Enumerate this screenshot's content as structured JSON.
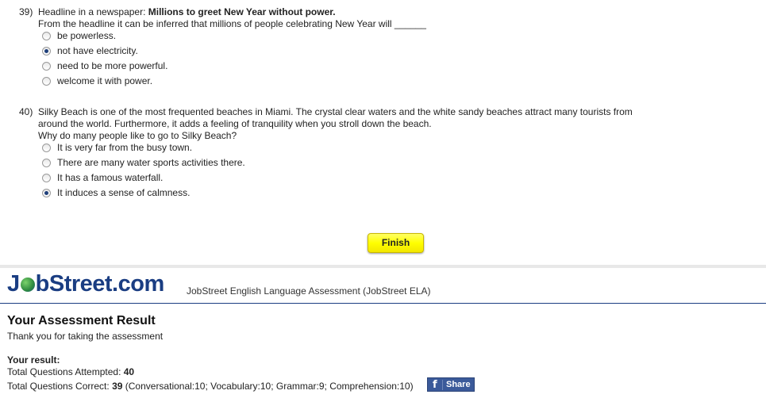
{
  "questions": [
    {
      "number": "39)",
      "prefix": "Headline in a newspaper: ",
      "headline": "Millions to greet New Year without power.",
      "lines": [
        "From the headline it can be inferred that millions of people celebrating New Year will ______"
      ],
      "options": [
        {
          "label": "be powerless.",
          "checked": false
        },
        {
          "label": "not have electricity.",
          "checked": true
        },
        {
          "label": "need to be more powerful.",
          "checked": false
        },
        {
          "label": "welcome it with power.",
          "checked": false
        }
      ]
    },
    {
      "number": "40)",
      "lines": [
        "Silky Beach is one of the most frequented beaches in Miami. The crystal clear waters and the white sandy beaches attract many tourists from",
        "around the world. Furthermore, it adds a feeling of tranquility when you stroll down the beach.",
        "Why do many people like to go to Silky Beach?"
      ],
      "options": [
        {
          "label": "It is very far from the busy town.",
          "checked": false
        },
        {
          "label": "There are many water sports activities there.",
          "checked": false
        },
        {
          "label": "It has a famous waterfall.",
          "checked": false
        },
        {
          "label": "It induces a sense of calmness.",
          "checked": true
        }
      ]
    }
  ],
  "finish_label": "Finish",
  "brand": {
    "logo_left": "J",
    "logo_right": "bStreet.com",
    "subtitle": "JobStreet English Language Assessment (JobStreet ELA)"
  },
  "result": {
    "heading": "Your Assessment Result",
    "thanks": "Thank you for taking the assessment",
    "your_result": "Your result:",
    "attempted_label": "Total Questions Attempted: ",
    "attempted_value": "40",
    "correct_label": "Total Questions Correct: ",
    "correct_value": "39",
    "breakdown": " (Conversational:10; Vocabulary:10; Grammar:9; Comprehension:10)"
  },
  "share": {
    "icon": "facebook-icon",
    "label": "Share"
  }
}
